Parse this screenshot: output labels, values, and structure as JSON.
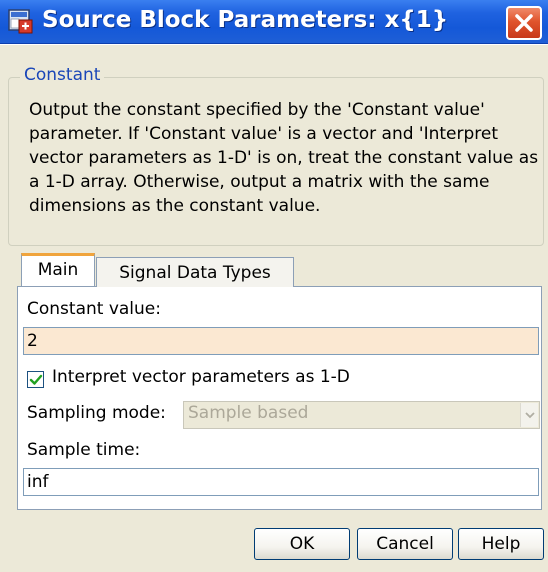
{
  "window": {
    "title": "Source Block Parameters: x{1}"
  },
  "group": {
    "title": "Constant",
    "description": "Output the constant specified by the 'Constant value' parameter. If 'Constant value' is a vector and 'Interpret vector parameters as 1-D' is on, treat the constant value as a 1-D array. Otherwise, output a matrix with the same dimensions as the constant value."
  },
  "tabs": [
    {
      "label": "Main",
      "active": true
    },
    {
      "label": "Signal Data Types",
      "active": false
    }
  ],
  "main": {
    "constant_value_label": "Constant value:",
    "constant_value": "2",
    "interpret_vector_label": "Interpret vector parameters as 1-D",
    "interpret_vector_checked": true,
    "sampling_mode_label": "Sampling mode:",
    "sampling_mode_value": "Sample based",
    "sampling_mode_enabled": false,
    "sample_time_label": "Sample time:",
    "sample_time_value": "inf"
  },
  "buttons": {
    "ok": "OK",
    "cancel": "Cancel",
    "help": "Help"
  },
  "colors": {
    "titlebar": "#1458d8",
    "close_button": "#e0542c",
    "dialog_background": "#ece9d8",
    "group_title": "#1a46b8",
    "active_tab_highlight": "#f0a43c",
    "constant_field_background": "#fbe8d2",
    "disabled_text": "#aca899",
    "checkmark": "#21a121"
  },
  "icons": {
    "app": "simulink-block-icon",
    "close": "close-icon",
    "checkbox": "checkmark-icon",
    "dropdown": "chevron-down-icon"
  }
}
